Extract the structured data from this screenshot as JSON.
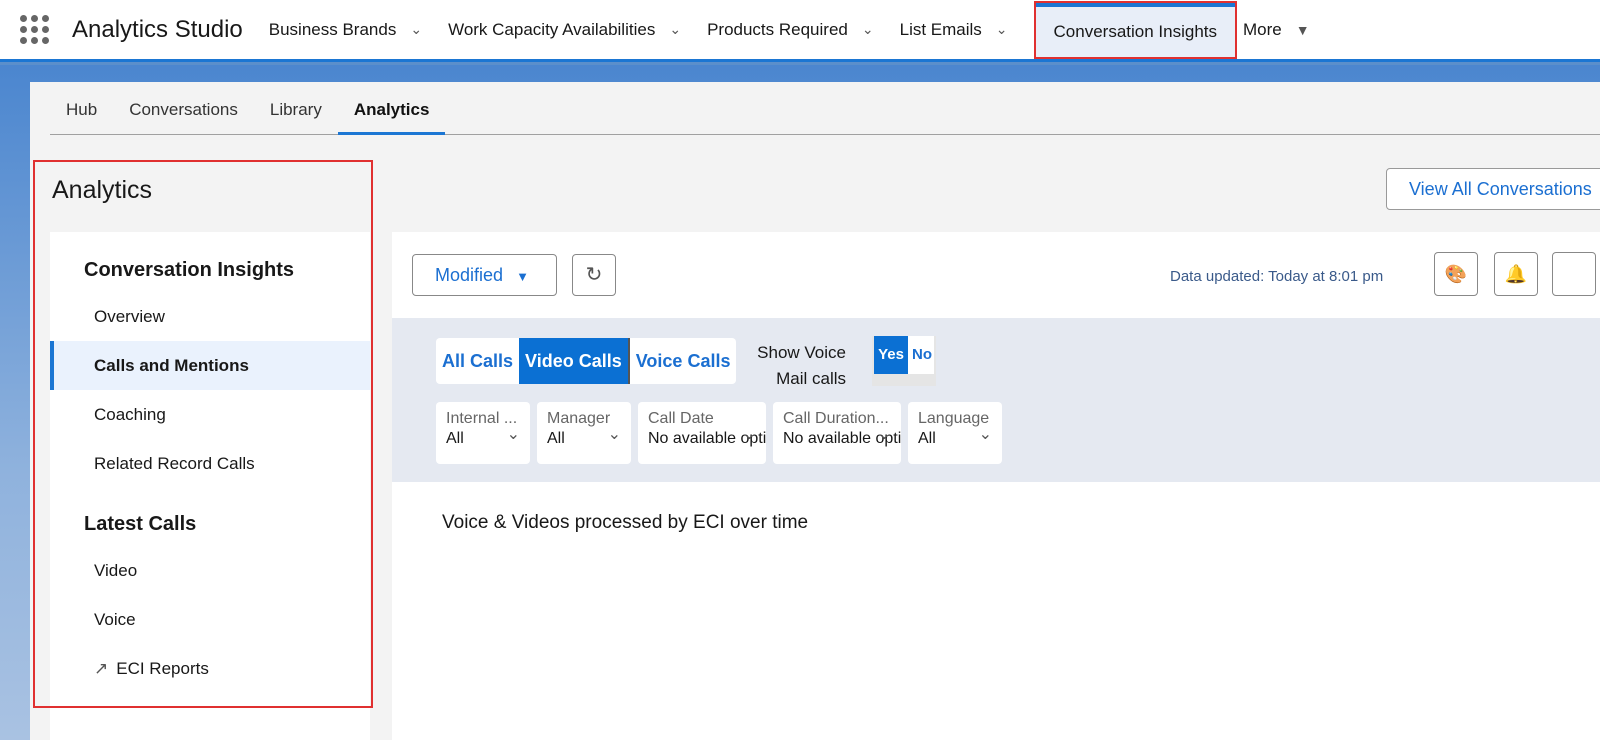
{
  "app": {
    "name": "Analytics Studio"
  },
  "nav": {
    "items": [
      {
        "label": "Business Brands"
      },
      {
        "label": "Work Capacity Availabilities"
      },
      {
        "label": "Products Required"
      },
      {
        "label": "List Emails"
      }
    ],
    "active": "Conversation Insights",
    "more": "More"
  },
  "tabs": [
    "Hub",
    "Conversations",
    "Library",
    "Analytics"
  ],
  "sidebar": {
    "title": "Analytics",
    "section1": "Conversation Insights",
    "items1": [
      "Overview",
      "Calls and Mentions",
      "Coaching",
      "Related Record Calls"
    ],
    "section2": "Latest Calls",
    "items2": [
      "Video",
      "Voice"
    ],
    "reports": "ECI Reports"
  },
  "header": {
    "view_all": "View All Conversations"
  },
  "toolbar": {
    "modified": "Modified",
    "updated": "Data updated: Today at 8:01 pm"
  },
  "filters": {
    "segments": [
      "All Calls",
      "Video Calls",
      "Voice Calls"
    ],
    "selected_segment": "Video Calls",
    "show_voicemail": "Show Voice Mail calls",
    "yes": "Yes",
    "no": "No",
    "dropdowns": [
      {
        "label": "Internal ...",
        "value": "All"
      },
      {
        "label": "Manager",
        "value": "All"
      },
      {
        "label": "Call Date",
        "value": "No available options"
      },
      {
        "label": "Call Duration...",
        "value": "No available options"
      },
      {
        "label": "Language",
        "value": "All"
      }
    ]
  },
  "chart": {
    "title": "Voice & Videos processed by ECI over time"
  },
  "colors": {
    "accent": "#0b70d3",
    "highlight": "#e03030"
  }
}
